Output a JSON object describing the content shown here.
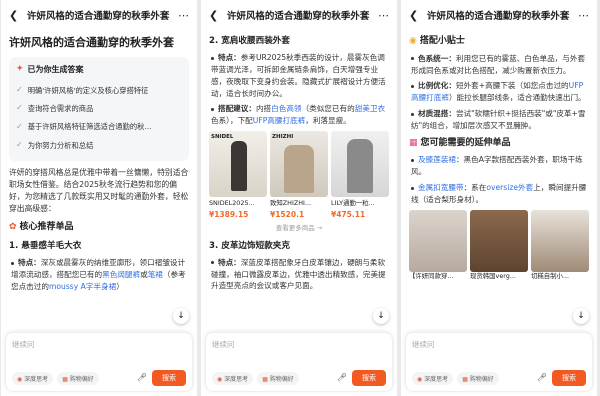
{
  "icons": {
    "back": "chevron-left-icon",
    "more": "more-dots-icon",
    "scroll": "arrow-down-icon",
    "mic": "mic-icon"
  },
  "colors": {
    "accent": "#f25a22",
    "link": "#2f6ee2",
    "price": "#f06a2c"
  },
  "panel1": {
    "title": "许妍风格的适合通勤穿的秋季外套",
    "gen_label": "已为你生成答案",
    "steps": [
      "明确'许妍风格'的定义及核心穿搭特征",
      "查询符合需求的商品",
      "基于许妍风格特征筛选适合通勤的秋...",
      "为你努力分析和总结"
    ],
    "intro": "许妍的穿搭风格总是优雅中带着一丝慵懒，特别适合职场女性借鉴。结合2025秋冬流行趋势和您的偏好，为您精选了几款既实用又时髦的通勤外套，轻松穿出高级感：",
    "section": "核心推荐单品",
    "sub": "1. 悬垂感羊毛大衣",
    "bullet_label": "特点：",
    "bullet_text": "深灰或晨雾灰的纳维亚廓形，领口褶皱设计增添流动感，搭配您已有的",
    "bullet_link1": "黑色阔腿裤",
    "bullet_mid": "或",
    "bullet_link2": "笔裙",
    "bullet_tail": "（参考您点击过的",
    "bullet_link3": "moussy A字半身裙",
    "bullet_end": "）"
  },
  "panel2": {
    "title": "许妍风格的适合通勤穿的秋季外套",
    "sub1": "2. 宽肩收腰西装外套",
    "b1_label": "特点：",
    "b1_text": "参考UR2025秋季西装的设计，晨雾灰色调带蓝调光泽，可拆卸金属链条肩饰，白天增强专业感，夜晚取下变身约会装。隐藏式扩展褶设计方便活动，适合长时间办公。",
    "b2_label": "搭配建议：",
    "b2_a": "内搭",
    "b2_link1": "白色高领",
    "b2_b": "（类似您已有的",
    "b2_link2": "甜美卫衣",
    "b2_c": "色系），下配",
    "b2_link3": "UFP高腰打底裤",
    "b2_d": "，利落显瘦。",
    "products": [
      {
        "brand": "SNIDEL",
        "name": "SNIDEL2025...",
        "price": "¥1389.15"
      },
      {
        "brand": "ZHIZHI",
        "name": "致知ZHIZHI...",
        "price": "¥1520.1"
      },
      {
        "brand": "",
        "name": "LILY通勤一粒...",
        "price": "¥475.11"
      }
    ],
    "more": "查看更多商品 →",
    "sub2": "3. 皮革边饰短款夹克",
    "b3_label": "特点：",
    "b3_text": "深蓝皮革搭配象牙白皮革镶边，硬朗与柔软碰撞，袖口微露皮革边，优雅中透出精致感，完美提升造型亮点的会议或客户见面。"
  },
  "panel3": {
    "title": "许妍风格的适合通勤穿的秋季外套",
    "h1": "搭配小贴士",
    "t1_label": "色系统一：",
    "t1_text": "利用您已有的雾蓝、白色单品，与外套形成同色系或对比色搭配，减少购置新衣压力。",
    "t2_label": "比例优化：",
    "t2_text": "短外套+高腰下装（如您点击过的",
    "t2_link": "UFP高腰打底裤",
    "t2_tail": "）能拉长腿部线条，适合通勤快速出门。",
    "t3_label": "材质混搭：",
    "t3_text": "尝试\"软糯针织+挺括西装\"或\"皮革+雪纺\"的组合，增加层次感又不显臃肿。",
    "h2": "您可能需要的延伸单品",
    "e1_link": "及膝莲装裙",
    "e1_text": "：黑色A字款搭配西装外套，职场干练风。",
    "e2_link": "金属扣宽腰带",
    "e2_a": "：系在",
    "e2_link2": "oversize外套",
    "e2_b": "上，瞬间提升腰线（适合梨形身材）。",
    "images": [
      {
        "caption": "【许妍同款穿..."
      },
      {
        "caption": "现货韩国verg..."
      },
      {
        "caption": "切糕自制小..."
      }
    ]
  },
  "input": {
    "placeholder": "继续问",
    "chip1": "深度思考",
    "chip2": "购物偏好",
    "send": "搜索"
  }
}
